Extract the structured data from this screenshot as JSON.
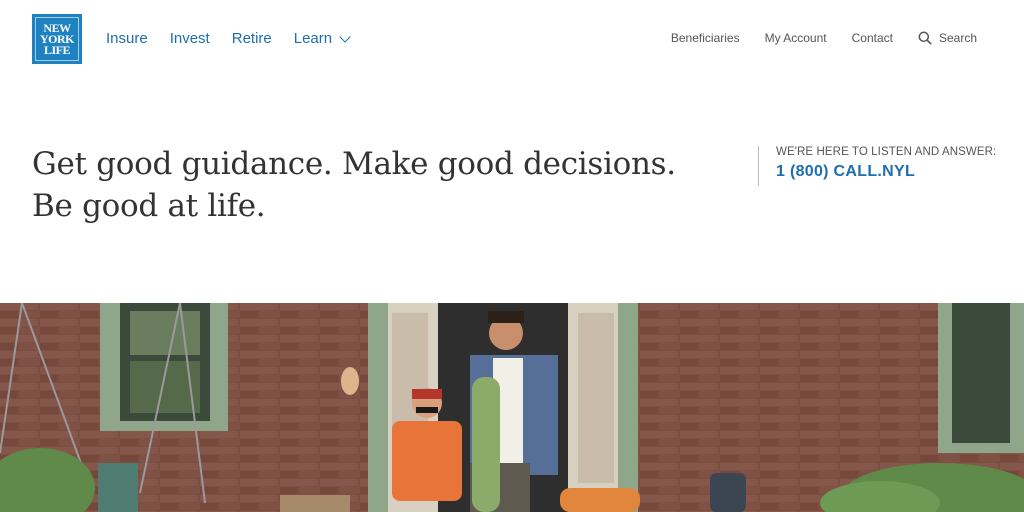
{
  "brand": {
    "logo_lines": [
      "NEW",
      "YORK",
      "LIFE"
    ],
    "logo_color": "#1f82c0"
  },
  "main_nav": {
    "insure": "Insure",
    "invest": "Invest",
    "retire": "Retire",
    "learn": "Learn"
  },
  "util_nav": {
    "beneficiaries": "Beneficiaries",
    "my_account": "My Account",
    "contact": "Contact",
    "search": "Search"
  },
  "hero": {
    "tagline_line1": "Get good guidance. Make good decisions.",
    "tagline_line2": "Be good at life.",
    "callout_label": "WE'RE HERE TO LISTEN AND ANSWER:",
    "callout_phone": "1 (800) CALL.NYL"
  },
  "colors": {
    "accent": "#1f6fad",
    "brick": "#7a4a3e",
    "trim": "#8fa68a"
  }
}
